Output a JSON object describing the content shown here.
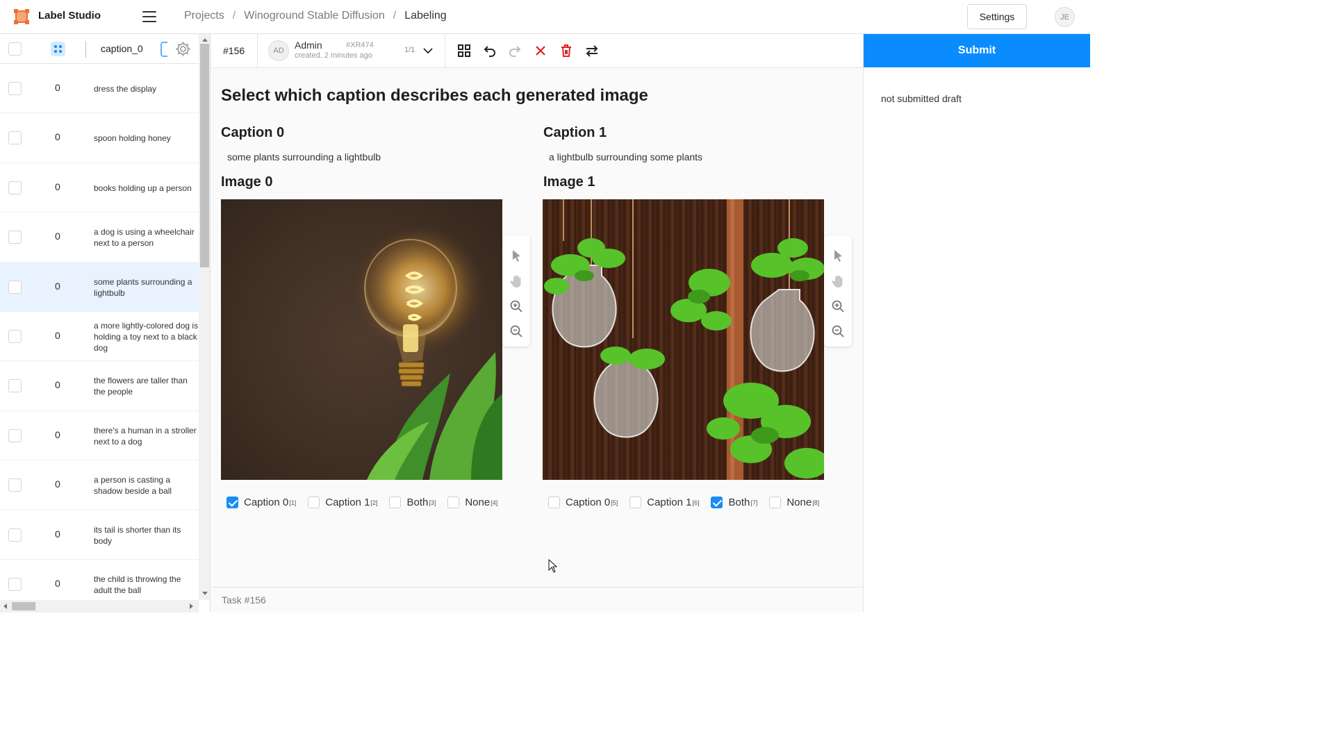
{
  "app": {
    "brand": "Label Studio"
  },
  "breadcrumb": {
    "projects": "Projects",
    "project": "Winoground Stable Diffusion",
    "current": "Labeling"
  },
  "header": {
    "settings": "Settings",
    "user_initials": "JE"
  },
  "datamanager": {
    "column_title": "caption_0",
    "rows": [
      {
        "count": "0",
        "caption": "dress the display",
        "selected": false
      },
      {
        "count": "0",
        "caption": "spoon holding honey",
        "selected": false
      },
      {
        "count": "0",
        "caption": "books holding up a person",
        "selected": false
      },
      {
        "count": "0",
        "caption": "a dog is using a wheelchair next to a person",
        "selected": false
      },
      {
        "count": "0",
        "caption": "some plants surrounding a lightbulb",
        "selected": true
      },
      {
        "count": "0",
        "caption": "a more lightly-colored dog is holding a toy next to a black dog",
        "selected": false
      },
      {
        "count": "0",
        "caption": "the flowers are taller than the people",
        "selected": false
      },
      {
        "count": "0",
        "caption": "there's a human in a stroller next to a dog",
        "selected": false
      },
      {
        "count": "0",
        "caption": "a person is casting a shadow beside a ball",
        "selected": false
      },
      {
        "count": "0",
        "caption": "its tail is shorter than its body",
        "selected": false
      },
      {
        "count": "0",
        "caption": "the child is throwing the adult the ball",
        "selected": false
      }
    ]
  },
  "toolbar": {
    "task_id": "#156",
    "annotator_initials": "AD",
    "annotator_name": "Admin",
    "created": "created, 2 minutes ago",
    "annotation_code": "#XR474",
    "count": "1/1"
  },
  "labeling": {
    "heading": "Select which caption describes each generated image",
    "caption0_title": "Caption 0",
    "caption0_text": "some plants surrounding a lightbulb",
    "caption1_title": "Caption 1",
    "caption1_text": "a lightbulb surrounding some plants",
    "image0_title": "Image 0",
    "image1_title": "Image 1",
    "choices_image0": [
      {
        "label": "Caption 0",
        "hotkey": "[1]",
        "checked": true
      },
      {
        "label": "Caption 1",
        "hotkey": "[2]",
        "checked": false
      },
      {
        "label": "Both",
        "hotkey": "[3]",
        "checked": false
      },
      {
        "label": "None",
        "hotkey": "[4]",
        "checked": false
      }
    ],
    "choices_image1": [
      {
        "label": "Caption 0",
        "hotkey": "[5]",
        "checked": false
      },
      {
        "label": "Caption 1",
        "hotkey": "[6]",
        "checked": false
      },
      {
        "label": "Both",
        "hotkey": "[7]",
        "checked": true
      },
      {
        "label": "None",
        "hotkey": "[8]",
        "checked": false
      }
    ],
    "footer": "Task #156"
  },
  "sidebar_right": {
    "submit": "Submit",
    "status": "not submitted draft"
  },
  "colors": {
    "accent": "#0a8cff",
    "delete": "#e02020",
    "selected_row": "#e9f3ff"
  }
}
